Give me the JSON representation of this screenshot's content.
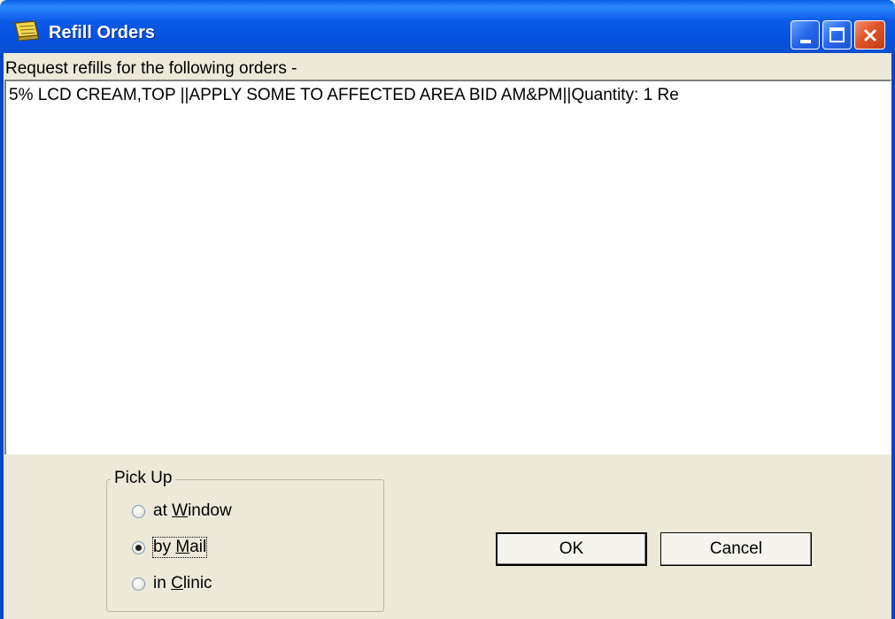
{
  "window": {
    "title": "Refill Orders",
    "icons": {
      "app": "order-book-icon",
      "minimize": "minimize-icon",
      "maximize": "maximize-icon",
      "close": "close-icon"
    },
    "colors": {
      "titlebar": "#0a5fe0",
      "close_button": "#e0522a",
      "dialog_bg": "#ece9d8"
    }
  },
  "request_label": "Request refills for the following orders -",
  "orders": [
    {
      "text": "5% LCD CREAM,TOP ||APPLY SOME TO AFFECTED AREA BID AM&PM||Quantity: 1 Re"
    }
  ],
  "pickup": {
    "legend": "Pick Up",
    "options": [
      {
        "before": "at ",
        "mnemonic": "W",
        "after": "indow",
        "checked": false
      },
      {
        "before": "by ",
        "mnemonic": "M",
        "after": "ail",
        "checked": true
      },
      {
        "before": "in ",
        "mnemonic": "C",
        "after": "linic",
        "checked": false
      }
    ]
  },
  "buttons": {
    "ok": "OK",
    "cancel": "Cancel"
  }
}
